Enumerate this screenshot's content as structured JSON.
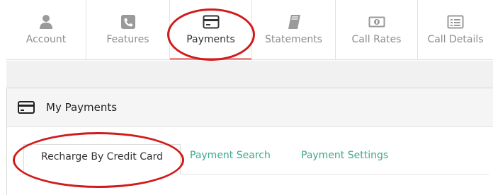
{
  "nav": {
    "items": [
      {
        "label": "Account",
        "icon": "user-icon"
      },
      {
        "label": "Features",
        "icon": "phone-icon"
      },
      {
        "label": "Payments",
        "icon": "credit-card-icon",
        "active": true
      },
      {
        "label": "Statements",
        "icon": "book-icon"
      },
      {
        "label": "Call Rates",
        "icon": "money-icon"
      },
      {
        "label": "Call Details",
        "icon": "list-icon"
      }
    ]
  },
  "panel": {
    "title": "My Payments",
    "icon": "credit-card-icon"
  },
  "subtabs": [
    {
      "label": "Recharge By Credit Card",
      "active": true
    },
    {
      "label": "Payment Search"
    },
    {
      "label": "Payment Settings"
    }
  ],
  "colors": {
    "link": "#3aa88c",
    "annotation": "#d11a1a",
    "active_underline": "#ea8c8c",
    "icon_gray": "#8c8c8c",
    "icon_dark": "#333333"
  }
}
